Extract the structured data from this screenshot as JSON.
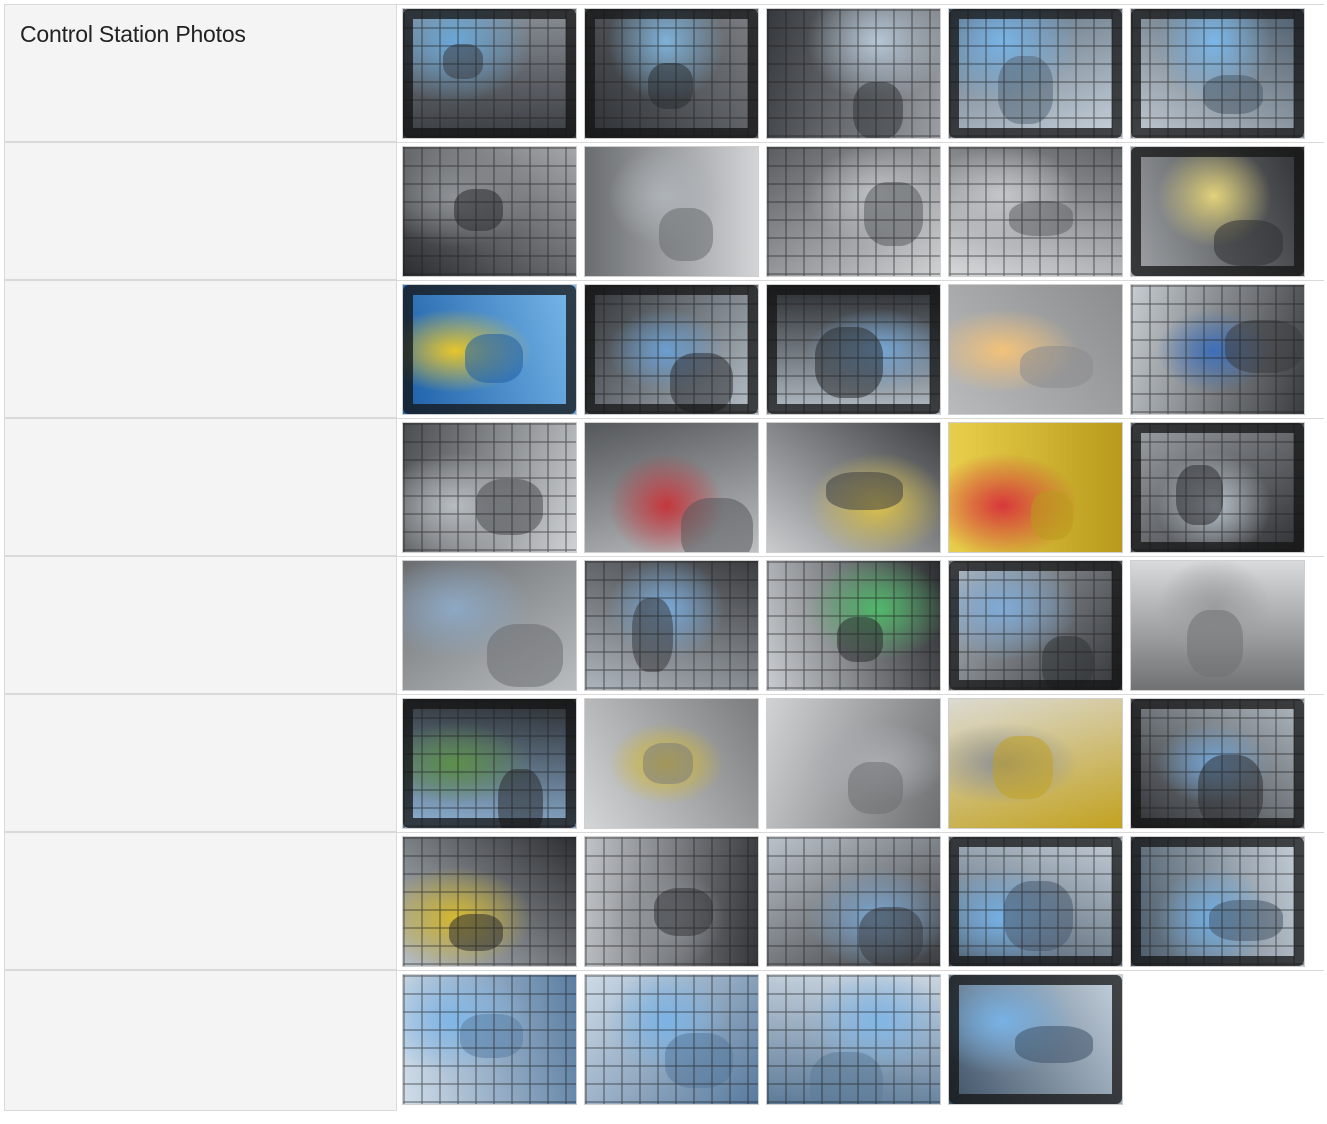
{
  "section": {
    "title": "Control Station Photos"
  },
  "rows": [
    {
      "thumbs": [
        {
          "icon": "cab-interior-photo",
          "bg": [
            "#3a3d42",
            "#8a8f96"
          ],
          "sky": "#6aa8d8",
          "grid": true,
          "frame": true
        },
        {
          "icon": "cab-interior-photo",
          "bg": [
            "#2c2f33",
            "#7d8186"
          ],
          "sky": "#7fb2d9",
          "grid": true,
          "frame": true
        },
        {
          "icon": "cab-seat-photo",
          "bg": [
            "#35383c",
            "#9a9ea3"
          ],
          "sky": "#b7c7d6",
          "grid": true,
          "frame": false
        },
        {
          "icon": "cab-window-photo",
          "bg": [
            "#58697a",
            "#c9d3dc"
          ],
          "sky": "#79b4e6",
          "grid": true,
          "frame": true
        },
        {
          "icon": "cab-window-photo",
          "bg": [
            "#4d5d6c",
            "#c2cad2"
          ],
          "sky": "#7bb7e8",
          "grid": true,
          "frame": true
        }
      ]
    },
    {
      "thumbs": [
        {
          "icon": "seat-photo",
          "bg": [
            "#2b2d30",
            "#a5a8ab"
          ],
          "sky": "#8e9296",
          "grid": true,
          "frame": false
        },
        {
          "icon": "lap-bar-photo",
          "bg": [
            "#6a6d70",
            "#d2d4d6"
          ],
          "sky": "#aeb3b8",
          "grid": false,
          "frame": false
        },
        {
          "icon": "seatbelt-photo",
          "bg": [
            "#5a5c5f",
            "#cfd1d3"
          ],
          "sky": "#bfc3c6",
          "grid": true,
          "frame": false
        },
        {
          "icon": "side-panel-photo",
          "bg": [
            "#606366",
            "#d6d8da"
          ],
          "sky": "#c4c7ca",
          "grid": true,
          "frame": false
        },
        {
          "icon": "rear-window-photo",
          "bg": [
            "#2f3133",
            "#9fa3a7"
          ],
          "sky": "#e2d27a",
          "grid": false,
          "frame": true
        }
      ]
    },
    {
      "thumbs": [
        {
          "icon": "front-view-photo",
          "bg": [
            "#1d5fa8",
            "#79b8ea"
          ],
          "sky": "#e6c52b",
          "grid": false,
          "frame": true
        },
        {
          "icon": "cab-window-photo",
          "bg": [
            "#2f3236",
            "#b8c2cb"
          ],
          "sky": "#6b9ed0",
          "grid": true,
          "frame": true
        },
        {
          "icon": "cab-window-photo",
          "bg": [
            "#2a2d31",
            "#b3bdc6"
          ],
          "sky": "#76a7d6",
          "grid": true,
          "frame": true
        },
        {
          "icon": "dome-light-photo",
          "bg": [
            "#8c8d8e",
            "#b9babb"
          ],
          "sky": "#f2c27a",
          "grid": false,
          "frame": false
        },
        {
          "icon": "joystick-photo",
          "bg": [
            "#3a3c3f",
            "#c6ccd1"
          ],
          "sky": "#3d6fb8",
          "grid": true,
          "frame": false
        }
      ]
    },
    {
      "thumbs": [
        {
          "icon": "lap-bar-photo",
          "bg": [
            "#4a4d50",
            "#cfd2d5"
          ],
          "sky": "#b7bcc1",
          "grid": true,
          "frame": false
        },
        {
          "icon": "floor-lever-photo",
          "bg": [
            "#55585b",
            "#bdbfc1"
          ],
          "sky": "#c4373d",
          "grid": false,
          "frame": false
        },
        {
          "icon": "foot-tray-photo",
          "bg": [
            "#3e4043",
            "#c9cbcd"
          ],
          "sky": "#d9c04a",
          "grid": false,
          "frame": false
        },
        {
          "icon": "yellow-frame-photo",
          "bg": [
            "#b99a1c",
            "#e8cf4b"
          ],
          "sky": "#d8373b",
          "grid": false,
          "frame": false
        },
        {
          "icon": "joystick-photo",
          "bg": [
            "#2e3033",
            "#9ea3a8"
          ],
          "sky": "#b8c1c9",
          "grid": true,
          "frame": true
        }
      ]
    },
    {
      "thumbs": [
        {
          "icon": "door-frame-photo",
          "bg": [
            "#6b6e71",
            "#b9bdc0"
          ],
          "sky": "#8da8c4",
          "grid": false,
          "frame": false
        },
        {
          "icon": "throttle-photo",
          "bg": [
            "#3b3d40",
            "#aeb5bc"
          ],
          "sky": "#79a9d8",
          "grid": true,
          "frame": false
        },
        {
          "icon": "gauge-panel-photo",
          "bg": [
            "#2b2d30",
            "#c9cdd1"
          ],
          "sky": "#51b86a",
          "grid": true,
          "frame": false
        },
        {
          "icon": "control-panel-photo",
          "bg": [
            "#323437",
            "#b5bcc3"
          ],
          "sky": "#7faad6",
          "grid": true,
          "frame": true
        },
        {
          "icon": "radio-photo",
          "bg": [
            "#6f7173",
            "#d8dadc"
          ],
          "sky": "#9a9c9e",
          "grid": false,
          "frame": false
        }
      ]
    },
    {
      "thumbs": [
        {
          "icon": "roof-grille-photo",
          "bg": [
            "#2a2c2e",
            "#8eb2d6"
          ],
          "sky": "#5d8f4a",
          "grid": true,
          "frame": true
        },
        {
          "icon": "heater-vents-photo",
          "bg": [
            "#7a7c7e",
            "#d3d5d7"
          ],
          "sky": "#d4b830",
          "grid": false,
          "frame": false
        },
        {
          "icon": "heater-vents-photo",
          "bg": [
            "#6d6f71",
            "#d0d2d4"
          ],
          "sky": "#a9acaf",
          "grid": false,
          "frame": false
        },
        {
          "icon": "floor-pedals-photo",
          "bg": [
            "#c2a220",
            "#dcdad2"
          ],
          "sky": "#8e9093",
          "grid": false,
          "frame": false
        },
        {
          "icon": "joystick-photo",
          "bg": [
            "#2f3134",
            "#b1bac2"
          ],
          "sky": "#72a4d4",
          "grid": true,
          "frame": true
        }
      ]
    },
    {
      "thumbs": [
        {
          "icon": "joystick-photo",
          "bg": [
            "#2d2f32",
            "#b9c0c7"
          ],
          "sky": "#d4b830",
          "grid": true,
          "frame": false
        },
        {
          "icon": "joystick-photo",
          "bg": [
            "#34363a",
            "#c0c4c8"
          ],
          "sky": "#8e9398",
          "grid": true,
          "frame": false
        },
        {
          "icon": "joystick-photo",
          "bg": [
            "#3a3c40",
            "#bcc3ca"
          ],
          "sky": "#7aa6d2",
          "grid": true,
          "frame": false
        },
        {
          "icon": "cab-door-photo",
          "bg": [
            "#4a5a6b",
            "#c4ced8"
          ],
          "sky": "#74b0e4",
          "grid": true,
          "frame": true
        },
        {
          "icon": "cab-door-photo",
          "bg": [
            "#485867",
            "#c7d0d9"
          ],
          "sky": "#6fadE2",
          "grid": true,
          "frame": true
        }
      ]
    },
    {
      "thumbs": [
        {
          "icon": "control-column-photo",
          "bg": [
            "#5b7ea3",
            "#d0dde9"
          ],
          "sky": "#7eb5e6",
          "grid": true,
          "frame": false
        },
        {
          "icon": "control-column-photo",
          "bg": [
            "#587a9e",
            "#cedbe7"
          ],
          "sky": "#7ab3e5",
          "grid": true,
          "frame": false
        },
        {
          "icon": "control-column-photo",
          "bg": [
            "#5d7b99",
            "#cbd6e1"
          ],
          "sky": "#80b6e6",
          "grid": true,
          "frame": false
        },
        {
          "icon": "door-glass-photo",
          "bg": [
            "#3e5267",
            "#c6d3df"
          ],
          "sky": "#78b2e5",
          "grid": false,
          "frame": true
        }
      ]
    }
  ]
}
